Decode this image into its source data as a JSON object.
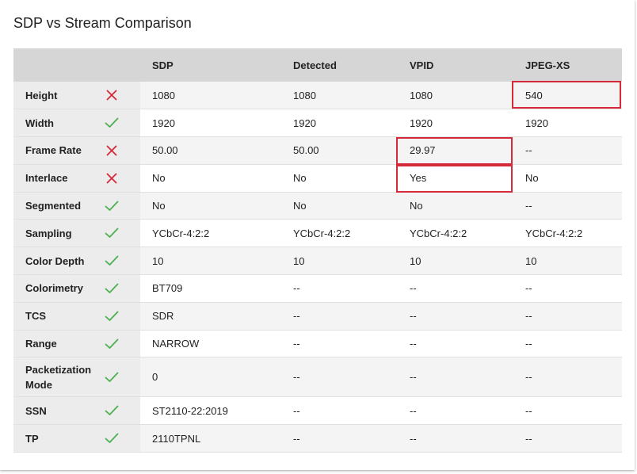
{
  "title": "SDP vs Stream Comparison",
  "columns": [
    "",
    "",
    "SDP",
    "Detected",
    "VPID",
    "JPEG-XS"
  ],
  "rows": [
    {
      "label": "Height",
      "status": "mismatch",
      "values": [
        "1080",
        "1080",
        "1080",
        "540"
      ]
    },
    {
      "label": "Width",
      "status": "match",
      "values": [
        "1920",
        "1920",
        "1920",
        "1920"
      ]
    },
    {
      "label": "Frame Rate",
      "status": "mismatch",
      "values": [
        "50.00",
        "50.00",
        "29.97",
        "--"
      ]
    },
    {
      "label": "Interlace",
      "status": "mismatch",
      "values": [
        "No",
        "No",
        "Yes",
        "No"
      ]
    },
    {
      "label": "Segmented",
      "status": "match",
      "values": [
        "No",
        "No",
        "No",
        "--"
      ]
    },
    {
      "label": "Sampling",
      "status": "match",
      "values": [
        "YCbCr-4:2:2",
        "YCbCr-4:2:2",
        "YCbCr-4:2:2",
        "YCbCr-4:2:2"
      ]
    },
    {
      "label": "Color Depth",
      "status": "match",
      "values": [
        "10",
        "10",
        "10",
        "10"
      ]
    },
    {
      "label": "Colorimetry",
      "status": "match",
      "values": [
        "BT709",
        "--",
        "--",
        "--"
      ]
    },
    {
      "label": "TCS",
      "status": "match",
      "values": [
        "SDR",
        "--",
        "--",
        "--"
      ]
    },
    {
      "label": "Range",
      "status": "match",
      "values": [
        "NARROW",
        "--",
        "--",
        "--"
      ]
    },
    {
      "label": "Packetization Mode",
      "status": "match",
      "values": [
        "0",
        "--",
        "--",
        "--"
      ]
    },
    {
      "label": "SSN",
      "status": "match",
      "values": [
        "ST2110-22:2019",
        "--",
        "--",
        "--"
      ]
    },
    {
      "label": "TP",
      "status": "match",
      "values": [
        "2110TPNL",
        "--",
        "--",
        "--"
      ]
    }
  ],
  "icons": {
    "match": "check-icon",
    "mismatch": "cross-icon"
  },
  "colors": {
    "match": "#4caf50",
    "mismatch": "#d6293a",
    "highlight": "#d6293a",
    "header_bg": "#d6d6d6"
  }
}
